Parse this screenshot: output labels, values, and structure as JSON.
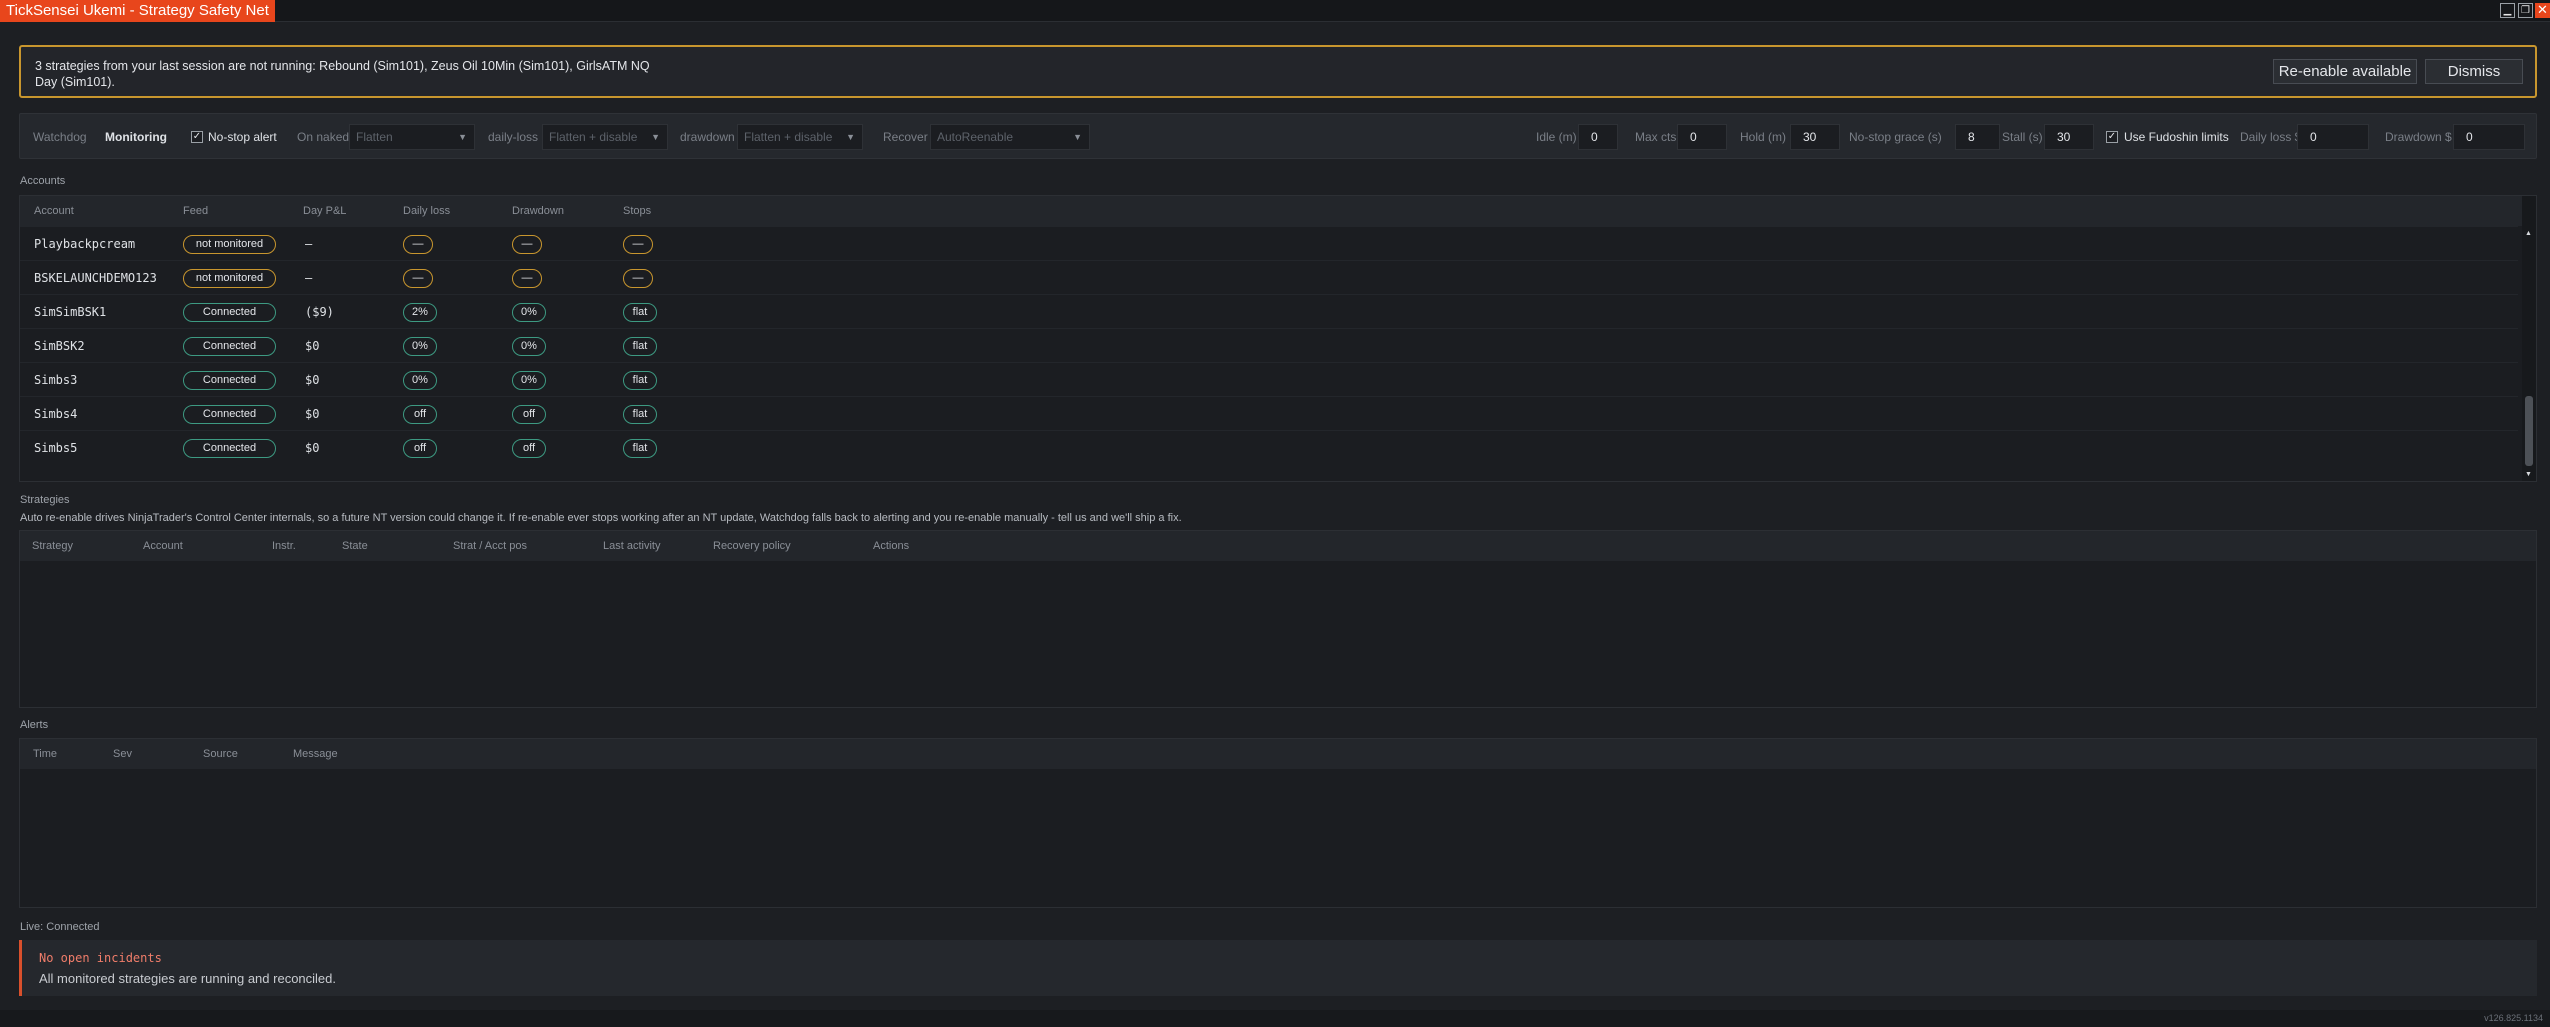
{
  "window": {
    "title": "TickSensei Ukemi - Strategy Safety Net"
  },
  "banner": {
    "message": "3 strategies from your last session are not running: Rebound (Sim101), Zeus Oil 10Min (Sim101), GirlsATM NQ Day (Sim101).",
    "reenable_label": "Re-enable available",
    "dismiss_label": "Dismiss"
  },
  "watchdog": {
    "label": "Watchdog",
    "status": "Monitoring",
    "no_stop_alert": {
      "label": "No-stop alert",
      "checked": true
    },
    "on_naked": {
      "label": "On naked",
      "value": "Flatten"
    },
    "daily_loss": {
      "label": "daily-loss",
      "value": "Flatten + disable"
    },
    "drawdown": {
      "label": "drawdown",
      "value": "Flatten + disable"
    },
    "recover": {
      "label": "Recover",
      "value": "AutoReenable"
    },
    "idle": {
      "label": "Idle (m)",
      "value": "0"
    },
    "max_cts": {
      "label": "Max cts",
      "value": "0"
    },
    "hold": {
      "label": "Hold (m)",
      "value": "30"
    },
    "no_stop_grace": {
      "label": "No-stop grace (s)",
      "value": "8"
    },
    "stall": {
      "label": "Stall (s)",
      "value": "30"
    },
    "fudoshin": {
      "label": "Use Fudoshin limits",
      "checked": true
    },
    "daily_loss_dollars": {
      "label": "Daily loss $",
      "value": "0"
    },
    "drawdown_dollars": {
      "label": "Drawdown $",
      "value": "0"
    }
  },
  "accounts": {
    "section_label": "Accounts",
    "columns": [
      "Account",
      "Feed",
      "Day P&L",
      "Daily loss",
      "Drawdown",
      "Stops"
    ],
    "rows": [
      {
        "account": "Playbackpcream",
        "feed": "not monitored",
        "feed_status": "warn",
        "pnl": "–",
        "daily_loss": "—",
        "drawdown": "—",
        "stops": "—",
        "badge_status": "warn"
      },
      {
        "account": "BSKELAUNCHDEMO123",
        "feed": "not monitored",
        "feed_status": "warn",
        "pnl": "–",
        "daily_loss": "—",
        "drawdown": "—",
        "stops": "—",
        "badge_status": "warn"
      },
      {
        "account": "SimSimBSK1",
        "feed": "Connected",
        "feed_status": "ok",
        "pnl": "($9)",
        "daily_loss": "2%",
        "drawdown": "0%",
        "stops": "flat",
        "badge_status": "ok"
      },
      {
        "account": "SimBSK2",
        "feed": "Connected",
        "feed_status": "ok",
        "pnl": "$0",
        "daily_loss": "0%",
        "drawdown": "0%",
        "stops": "flat",
        "badge_status": "ok"
      },
      {
        "account": "Simbs3",
        "feed": "Connected",
        "feed_status": "ok",
        "pnl": "$0",
        "daily_loss": "0%",
        "drawdown": "0%",
        "stops": "flat",
        "badge_status": "ok"
      },
      {
        "account": "Simbs4",
        "feed": "Connected",
        "feed_status": "ok",
        "pnl": "$0",
        "daily_loss": "off",
        "drawdown": "off",
        "stops": "flat",
        "badge_status": "ok"
      },
      {
        "account": "Simbs5",
        "feed": "Connected",
        "feed_status": "ok",
        "pnl": "$0",
        "daily_loss": "off",
        "drawdown": "off",
        "stops": "flat",
        "badge_status": "ok"
      }
    ]
  },
  "strategies": {
    "section_label": "Strategies",
    "note": "Auto re-enable drives NinjaTrader's Control Center internals, so a future NT version could change it. If re-enable ever stops working after an NT update, Watchdog falls back to alerting and you re-enable manually - tell us and we'll ship a fix.",
    "columns": [
      "Strategy",
      "Account",
      "Instr.",
      "State",
      "Strat / Acct pos",
      "Last activity",
      "Recovery policy",
      "Actions"
    ]
  },
  "alerts": {
    "section_label": "Alerts",
    "columns": [
      "Time",
      "Sev",
      "Source",
      "Message"
    ]
  },
  "live": {
    "label": "Live: Connected",
    "title": "No open incidents",
    "message": "All monitored strategies are running and reconciled."
  },
  "version": "v126.825.1134",
  "colors": {
    "accent": "#e8461c",
    "warn": "#c8962e",
    "ok": "#3d9a82",
    "incident": "#d9502c"
  }
}
